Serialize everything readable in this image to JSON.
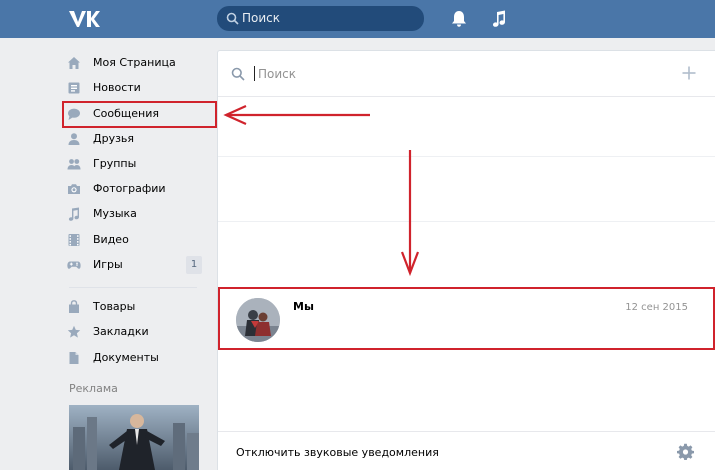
{
  "header": {
    "logo_text": "VK",
    "search_placeholder": "Поиск",
    "bg_color": "#4a76a8"
  },
  "sidebar": {
    "items": [
      {
        "label": "Моя Страница",
        "icon": "home-icon"
      },
      {
        "label": "Новости",
        "icon": "news-icon"
      },
      {
        "label": "Сообщения",
        "icon": "messages-icon"
      },
      {
        "label": "Друзья",
        "icon": "friends-icon"
      },
      {
        "label": "Группы",
        "icon": "groups-icon"
      },
      {
        "label": "Фотографии",
        "icon": "camera-icon"
      },
      {
        "label": "Музыка",
        "icon": "music-icon"
      },
      {
        "label": "Видео",
        "icon": "video-icon"
      },
      {
        "label": "Игры",
        "icon": "games-icon"
      },
      {
        "label": "Товары",
        "icon": "shopping-bag-icon"
      },
      {
        "label": "Закладки",
        "icon": "star-icon"
      },
      {
        "label": "Документы",
        "icon": "document-icon"
      }
    ],
    "games_badge": "1",
    "ads_title": "Реклама"
  },
  "messages": {
    "search_placeholder": "Поиск",
    "conversation": {
      "name": "Мы",
      "date": "12 сен 2015"
    },
    "footer_text": "Отключить звуковые уведомления"
  },
  "annotation": {
    "color": "#d0232c"
  }
}
